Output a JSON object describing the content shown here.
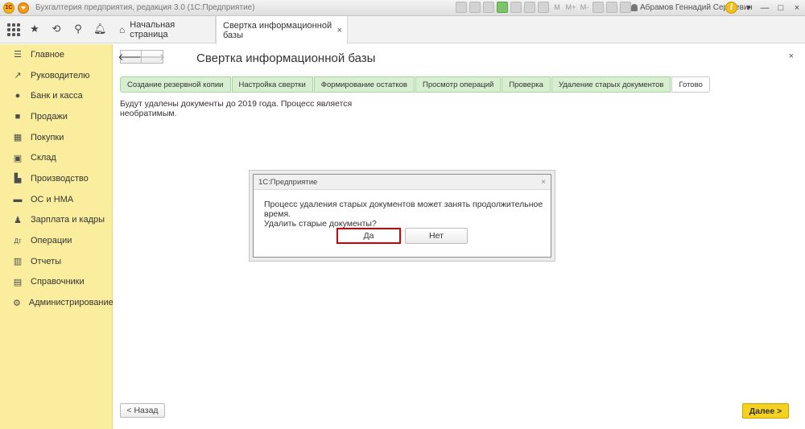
{
  "window": {
    "logo": "1С",
    "title": "Бухгалтерия предприятия, редакция 3.0  (1С:Предприятие)",
    "toolbar_letters": [
      "M",
      "M+",
      "M-"
    ],
    "user_name": "Абрамов Геннадий Сергеевич",
    "info_label": "i",
    "minimize_label": "—",
    "maximize_label": "□",
    "close_label": "×"
  },
  "tabs": [
    {
      "label": "Начальная страница",
      "icon": "home-icon",
      "active": false
    },
    {
      "label": "Свертка информационной базы",
      "active": true,
      "close_label": "×"
    }
  ],
  "sidebar": {
    "items": [
      {
        "label": "Главное",
        "icon": "menu-lines-icon"
      },
      {
        "label": "Руководителю",
        "icon": "trend-up-icon"
      },
      {
        "label": "Банк и касса",
        "icon": "ruble-coin-icon"
      },
      {
        "label": "Продажи",
        "icon": "shopping-bag-icon"
      },
      {
        "label": "Покупки",
        "icon": "cart-icon"
      },
      {
        "label": "Склад",
        "icon": "warehouse-icon"
      },
      {
        "label": "Производство",
        "icon": "factory-icon"
      },
      {
        "label": "ОС и НМА",
        "icon": "truck-icon"
      },
      {
        "label": "Зарплата и кадры",
        "icon": "person-icon"
      },
      {
        "label": "Операции",
        "icon": "debit-credit-icon"
      },
      {
        "label": "Отчеты",
        "icon": "bar-chart-icon"
      },
      {
        "label": "Справочники",
        "icon": "book-icon"
      },
      {
        "label": "Администрирование",
        "icon": "gear-icon"
      }
    ]
  },
  "content": {
    "title": "Свертка информационной базы",
    "back_arrow": "🡐",
    "forward_arrow": "🡒",
    "close_label": "×",
    "steps": [
      {
        "label": "Создание резервной копии",
        "done": true
      },
      {
        "label": "Настройка свертки",
        "done": true
      },
      {
        "label": "Формирование остатков",
        "done": true
      },
      {
        "label": "Просмотр операций",
        "done": true
      },
      {
        "label": "Проверка",
        "done": true
      },
      {
        "label": "Удаление старых документов",
        "done": true
      },
      {
        "label": "Готово",
        "done": false
      }
    ],
    "notice": "Будут удалены документы до 2019 года. Процесс является необратимым.",
    "back_button": "< Назад",
    "next_button": "Далее >"
  },
  "dialog": {
    "title": "1С:Предприятие",
    "close_label": "×",
    "message_line1": "Процесс удаления старых документов может занять продолжительное время.",
    "message_line2": "Удалить старые документы?",
    "yes_button": "Да",
    "no_button": "Нет"
  },
  "colors": {
    "sidebar_bg": "#fbed9e",
    "step_done_bg": "#d7efd0",
    "primary_button_bg": "#f5d220",
    "highlight_border": "#d40000"
  }
}
